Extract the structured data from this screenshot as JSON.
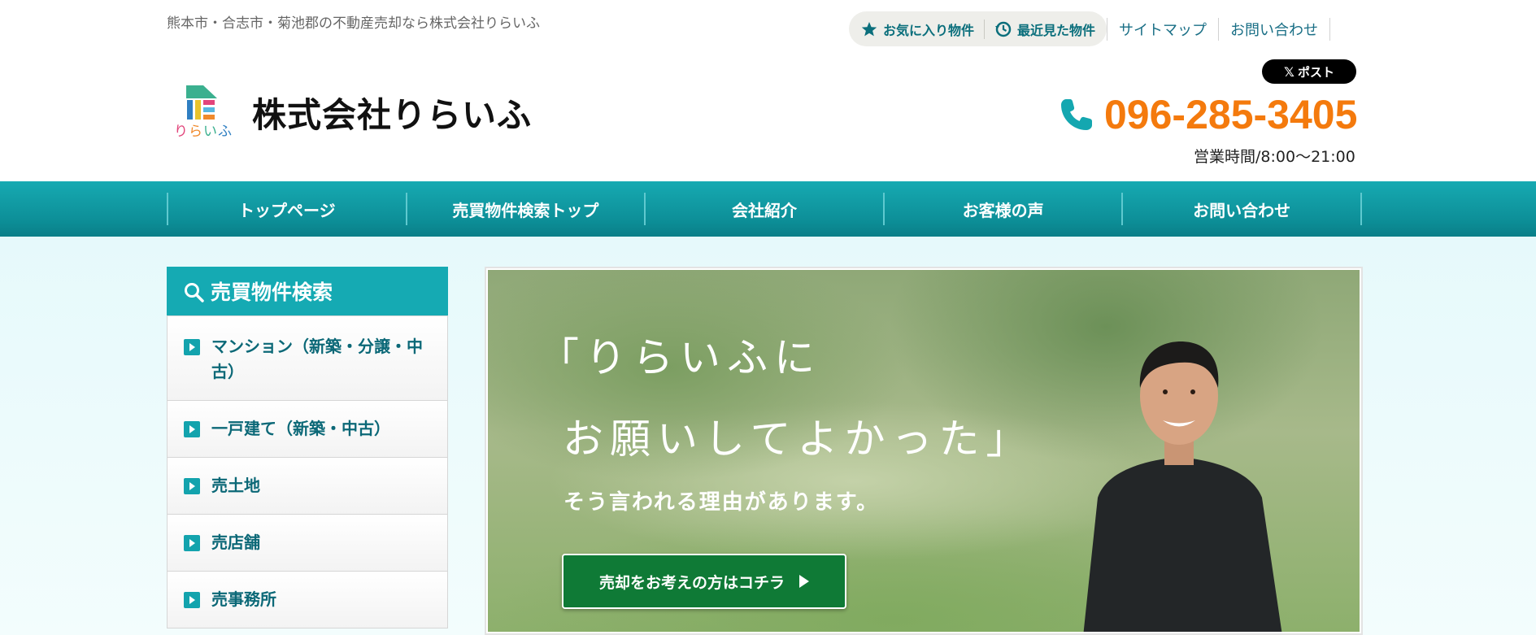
{
  "header": {
    "tagline": "熊本市・合志市・菊池郡の不動産売却なら株式会社りらいふ",
    "favorites_label": "お気に入り物件",
    "recent_label": "最近見た物件",
    "sitemap_label": "サイトマップ",
    "contact_label": "お問い合わせ",
    "x_post_label": "ポスト",
    "x_glyph": "𝕏",
    "logo_text": "りらいふ",
    "company_name": "株式会社りらいふ",
    "phone": "096-285-3405",
    "hours": "営業時間/8:00～21:00",
    "accent_color": "#f47a0d"
  },
  "nav": {
    "items": [
      "トップページ",
      "売買物件検索トップ",
      "会社紹介",
      "お客様の声",
      "お問い合わせ"
    ],
    "color": "#15aab3"
  },
  "sidebar": {
    "title": "売買物件検索",
    "items": [
      "マンション（新築・分譲・中古）",
      "一戸建て（新築・中古）",
      "売土地",
      "売店舗",
      "売事務所"
    ]
  },
  "hero": {
    "quote_line1": "「りらいふに",
    "quote_line2": "お願いしてよかった」",
    "subtitle": "そう言われる理由があります。",
    "cta_label": "売却をお考えの方はコチラ",
    "cta_color": "#0f7a36"
  }
}
